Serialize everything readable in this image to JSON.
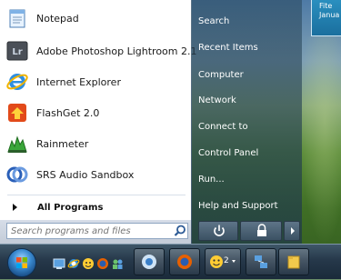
{
  "start_menu": {
    "programs": [
      {
        "label": "Notepad",
        "icon": "notepad-icon"
      },
      {
        "label": "Adobe Photoshop Lightroom 2.1",
        "icon": "lightroom-icon"
      },
      {
        "label": "Internet Explorer",
        "icon": "internet-explorer-icon"
      },
      {
        "label": "FlashGet 2.0",
        "icon": "flashget-icon"
      },
      {
        "label": "Rainmeter",
        "icon": "rainmeter-icon"
      },
      {
        "label": "SRS Audio Sandbox",
        "icon": "srs-audio-sandbox-icon"
      }
    ],
    "lightroom_badge": "Lr",
    "all_programs_label": "All Programs",
    "search_placeholder": "Search programs and files",
    "places": [
      "Search",
      "Recent Items",
      "Computer",
      "Network",
      "Connect to",
      "Control Panel",
      "Run...",
      "Help and Support"
    ]
  },
  "gadget": {
    "line1": "Fite",
    "line2": "Janua"
  },
  "taskbar": {
    "buttons": [
      "media-player-icon",
      "firefox-icon",
      "messenger-icon",
      "network-icon",
      "folder-icon"
    ],
    "messenger_count": "2"
  },
  "colors": {
    "menu_left_bg": "#ffffff",
    "menu_right_bg": "#2c4656",
    "taskbar_bg": "#22364a",
    "accent": "#3a8ad0"
  }
}
